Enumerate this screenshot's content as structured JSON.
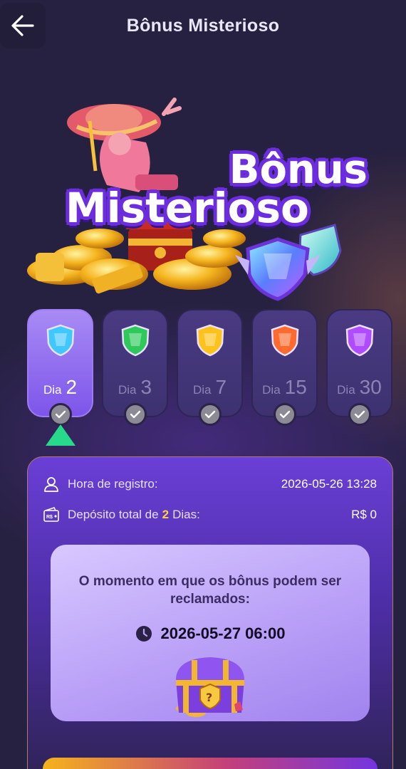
{
  "header": {
    "title": "Bônus Misterioso",
    "back_icon": "arrow-left-icon"
  },
  "hero": {
    "title_line1": "Bônus",
    "title_line2": "Misterioso"
  },
  "days": [
    {
      "word": "Dia",
      "number": "2",
      "active": true,
      "shield_color": "#3fc7ff",
      "checked": true
    },
    {
      "word": "Dia",
      "number": "3",
      "active": false,
      "shield_color": "#2ec95a",
      "checked": true
    },
    {
      "word": "Dia",
      "number": "7",
      "active": false,
      "shield_color": "#ffc21a",
      "checked": true
    },
    {
      "word": "Dia",
      "number": "15",
      "active": false,
      "shield_color": "#ff6a2e",
      "checked": true
    },
    {
      "word": "Dia",
      "number": "30",
      "active": false,
      "shield_color": "#b04bff",
      "checked": true
    }
  ],
  "info": {
    "registration_label": "Hora de registro:",
    "registration_value": "2026-05-26 13:28",
    "deposit_label_prefix": "Depósito total de",
    "deposit_days": "2",
    "deposit_label_suffix": "Dias:",
    "deposit_value": "R$ 0"
  },
  "claim": {
    "text": "O momento em que os bônus podem ser reclamados:",
    "time": "2026-05-27 06:00",
    "clock_icon": "clock-icon",
    "chest_icon": "treasure-chest-icon"
  },
  "colors": {
    "background": "#262140",
    "active_card": "#8a66ee",
    "pointer": "#27d98b",
    "highlight": "#ffd23f"
  }
}
